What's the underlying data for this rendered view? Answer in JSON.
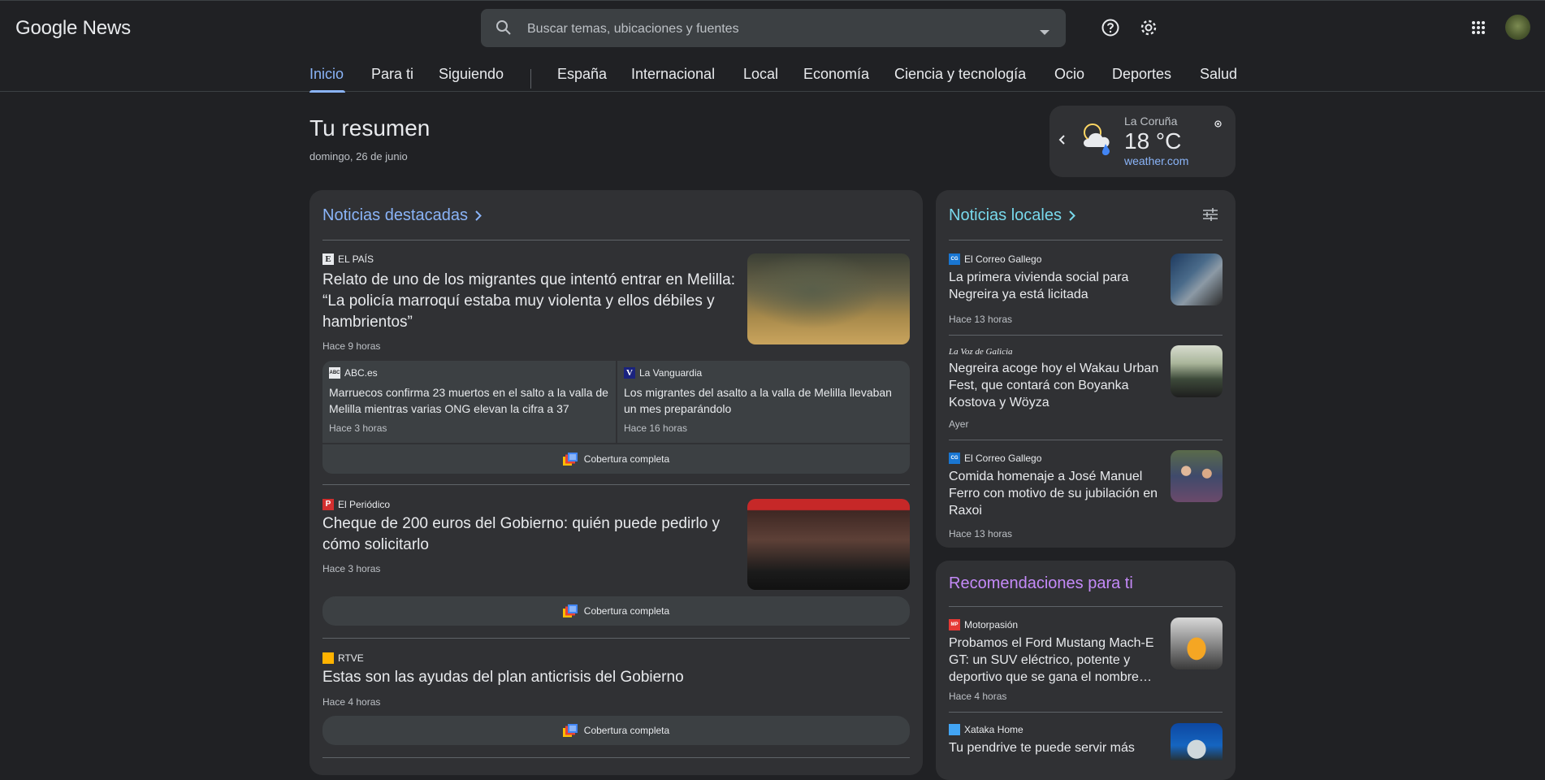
{
  "app": {
    "title": "Google News"
  },
  "search": {
    "placeholder": "Buscar temas, ubicaciones y fuentes"
  },
  "header_icons": [
    "help-icon",
    "settings-icon",
    "apps-icon",
    "avatar"
  ],
  "nav": {
    "tabs": [
      "Inicio",
      "Para ti",
      "Siguiendo",
      "España",
      "Internacional",
      "Local",
      "Economía",
      "Ciencia y tecnología",
      "Ocio",
      "Deportes",
      "Salud"
    ],
    "active": "Inicio"
  },
  "summary": {
    "title": "Tu resumen",
    "date": "domingo, 26 de junio"
  },
  "weather": {
    "city": "La Coruña",
    "temp": "18 °C",
    "source": "weather.com"
  },
  "top_stories": {
    "heading": "Noticias destacadas",
    "full_coverage": "Cobertura completa",
    "stories": [
      {
        "source": "EL PAÍS",
        "headline": "Relato de uno de los migrantes que intentó entrar en Melilla: “La policía marroquí estaba muy violenta y ellos débiles y hambrientos”",
        "time": "Hace 9 horas",
        "related": [
          {
            "source": "ABC.es",
            "title": "Marruecos confirma 23 muertos en el salto a la valla de Melilla mientras varias ONG elevan la cifra a 37",
            "time": "Hace 3 horas"
          },
          {
            "source": "La Vanguardia",
            "title": "Los migrantes del asalto a la valla de Melilla llevaban un mes preparándolo",
            "time": "Hace 16 horas"
          }
        ]
      },
      {
        "source": "El Periódico",
        "headline": "Cheque de 200 euros del Gobierno: quién puede pedirlo y cómo solicitarlo",
        "time": "Hace 3 horas"
      },
      {
        "source": "RTVE",
        "headline": "Estas son las ayudas del plan anticrisis del Gobierno",
        "time": "Hace 4 horas"
      }
    ]
  },
  "local_news": {
    "heading": "Noticias locales",
    "items": [
      {
        "source": "El Correo Gallego",
        "headline": "La primera vivienda social para Negreira ya está licitada",
        "time": "Hace 13 horas"
      },
      {
        "source": "La Voz de Galicia",
        "headline": "Negreira acoge hoy el Wakau Urban Fest, que contará con Boyanka Kostova y Wöyza",
        "time": "Ayer"
      },
      {
        "source": "El Correo Gallego",
        "headline": "Comida homenaje a José Manuel Ferro con motivo de su jubilación en Raxoi",
        "time": "Hace 13 horas"
      }
    ]
  },
  "recommendations": {
    "heading": "Recomendaciones para ti",
    "items": [
      {
        "source": "Motorpasión",
        "headline": "Probamos el Ford Mustang Mach-E GT: un SUV eléctrico, potente y deportivo que se gana el nombre…",
        "time": "Hace 4 horas"
      },
      {
        "source": "Xataka Home",
        "headline": "Tu pendrive te puede servir más",
        "time": ""
      }
    ]
  },
  "colors": {
    "accent_blue": "#8ab4f8",
    "teal": "#78d9ec",
    "purple": "#c58af9",
    "bg": "#202124",
    "card": "#303134"
  }
}
